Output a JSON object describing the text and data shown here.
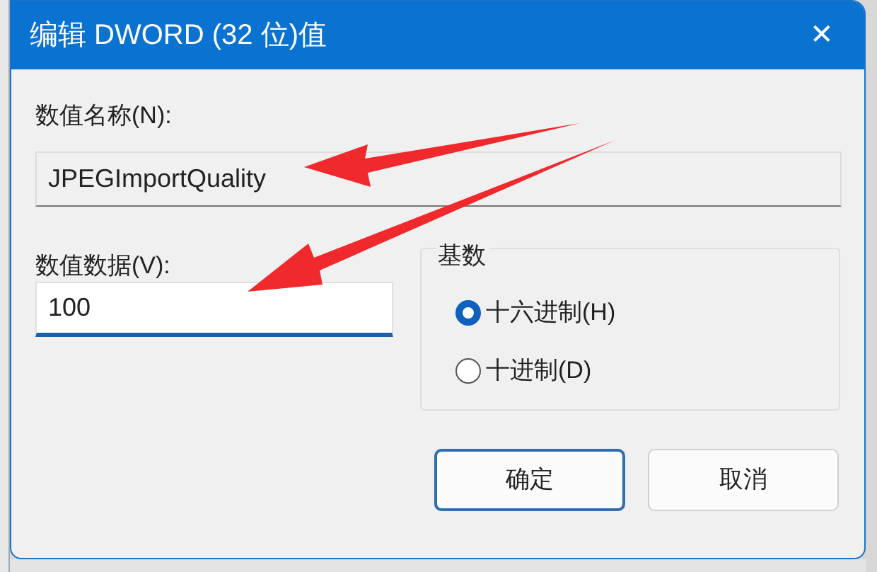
{
  "window": {
    "title": "编辑 DWORD (32 位)值",
    "close": "✕"
  },
  "value_name": {
    "label": "数值名称(N):",
    "value": "JPEGImportQuality"
  },
  "value_data": {
    "label": "数值数据(V):",
    "value": "100"
  },
  "base": {
    "title": "基数",
    "options": [
      {
        "label": "十六进制(H)",
        "selected": true
      },
      {
        "label": "十进制(D)",
        "selected": false
      }
    ]
  },
  "buttons": [
    "确定",
    "取消"
  ]
}
